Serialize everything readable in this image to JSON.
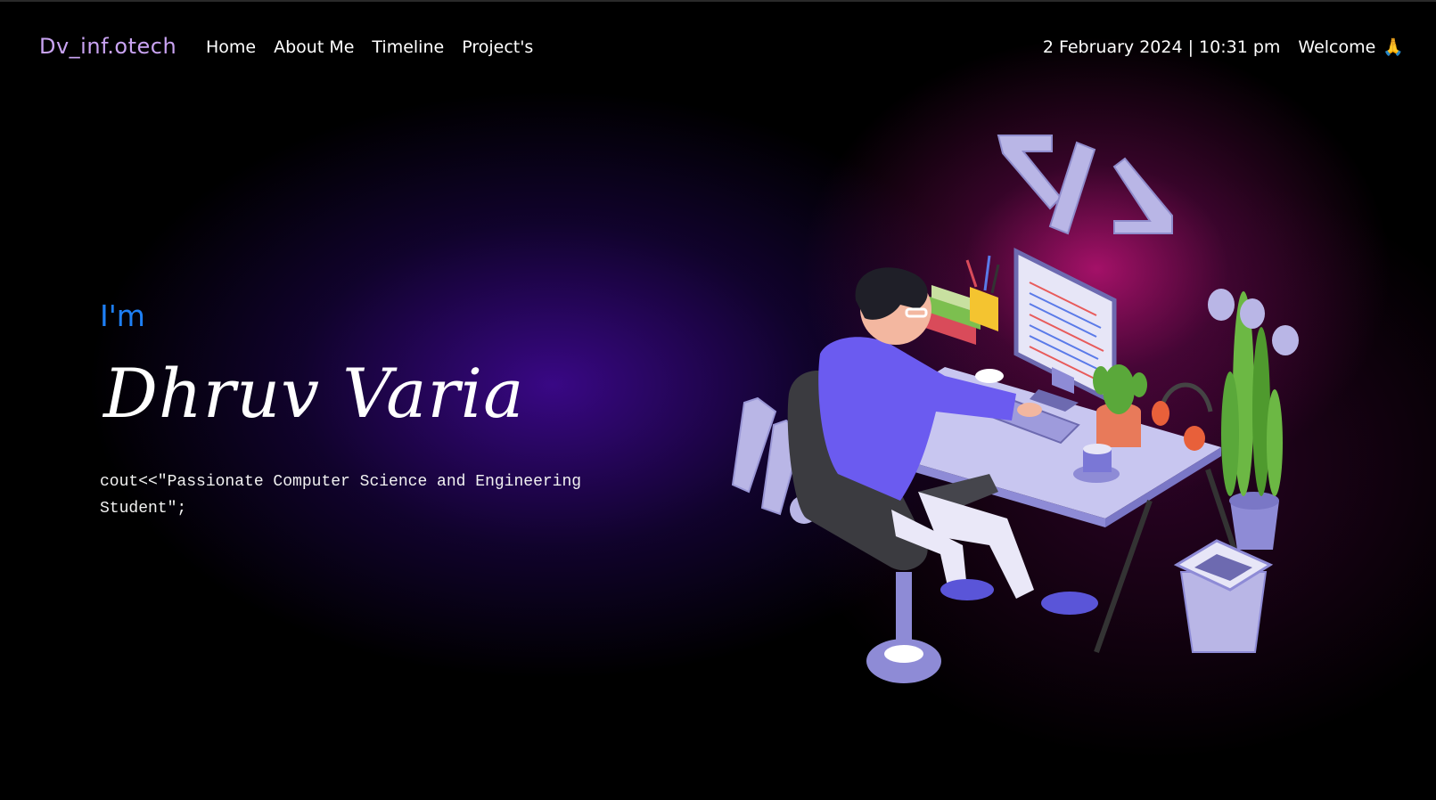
{
  "navbar": {
    "brand": "Dv_inf.otech",
    "links": [
      {
        "label": "Home"
      },
      {
        "label": "About Me"
      },
      {
        "label": "Timeline"
      },
      {
        "label": "Project's"
      }
    ],
    "datetime": "2 February 2024 | 10:31 pm",
    "welcome": "Welcome",
    "welcome_icon": "🙏"
  },
  "hero": {
    "intro": "I'm",
    "name": "Dhruv Varia",
    "tagline": "cout<<\"Passionate Computer Science and Engineering Student\";"
  },
  "illustration": {
    "code_symbol": "</>"
  },
  "colors": {
    "brand": "#c9a3f2",
    "intro": "#1e7ff5",
    "accent_purple": "#3c088c",
    "accent_magenta": "#be1478"
  }
}
